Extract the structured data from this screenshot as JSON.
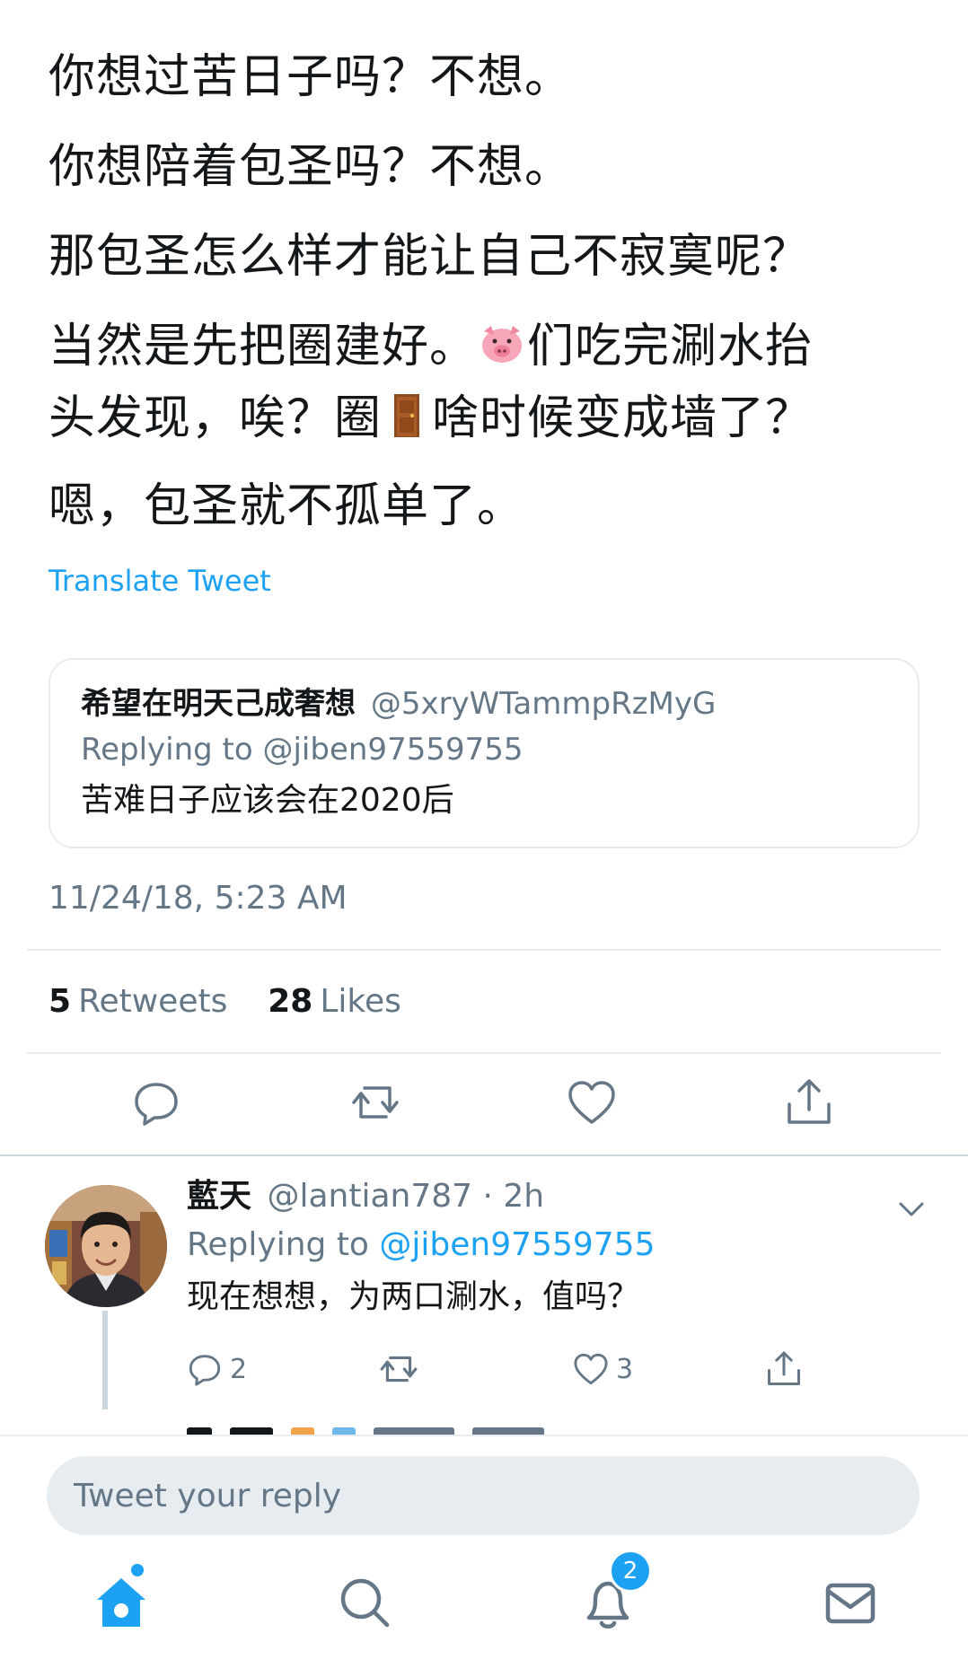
{
  "tweet": {
    "lines": [
      "你想过苦日子吗？不想。",
      "你想陪着包圣吗？不想。",
      "那包圣怎么样才能让自己不寂寞呢？",
      "当然是先把圈建好。",
      "们吃完涮水抬",
      "头发现，唉？圈",
      "啥时候变成墙了？",
      "嗯，包圣就不孤单了。"
    ],
    "emoji_pig": "pig-face-emoji",
    "emoji_door": "door-emoji",
    "translate_label": "Translate Tweet",
    "timestamp": "11/24/18, 5:23 AM"
  },
  "quote": {
    "name": "希望在明天己成奢想",
    "handle": "@5xryWTammpRzMyG",
    "replying": "Replying to @jiben97559755",
    "text": "苦难日子应该会在2020后"
  },
  "stats": {
    "retweets_count": "5",
    "retweets_label": "Retweets",
    "likes_count": "28",
    "likes_label": "Likes"
  },
  "actions": [
    "reply-icon",
    "retweet-icon",
    "like-icon",
    "share-icon"
  ],
  "reply": {
    "name": "藍天",
    "handle": "@lantian787 · 2h",
    "replying_prefix": "Replying to",
    "replying_link": "@jiben97559755",
    "text": "现在想想，为两口涮水，值吗？",
    "reply_count": "2",
    "like_count": "3"
  },
  "compose": {
    "placeholder": "Tweet your reply"
  },
  "tabs": {
    "notifications_badge": "2"
  },
  "colors": {
    "accent": "#1da1f2",
    "secondary_text": "#657786",
    "divider": "#e6ecf0"
  }
}
